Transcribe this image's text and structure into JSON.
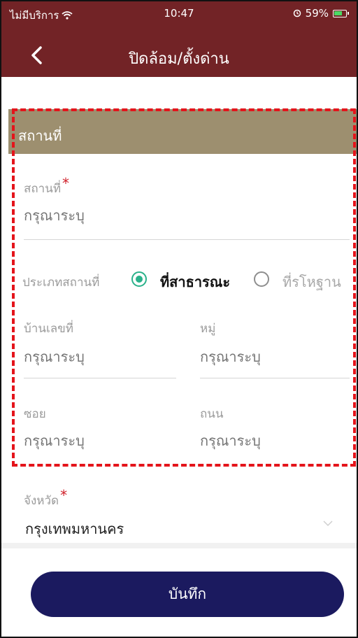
{
  "status_bar": {
    "carrier": "ไม่มีบริการ",
    "time": "10:47",
    "battery": "59%"
  },
  "header": {
    "title": "ปิดล้อม/ตั้งด่าน",
    "back_icon": "chevron-left-icon"
  },
  "section": {
    "title": "สถานที่"
  },
  "form": {
    "place": {
      "label": "สถานที่",
      "required_mark": "*",
      "placeholder": "กรุณาระบุ"
    },
    "place_type": {
      "label": "ประเภทสถานที่",
      "options": [
        {
          "label": "ที่สาธารณะ",
          "selected": true
        },
        {
          "label": "ที่รโหฐาน",
          "selected": false
        }
      ]
    },
    "house_no": {
      "label": "บ้านเลขที่",
      "placeholder": "กรุณาระบุ"
    },
    "moo": {
      "label": "หมู่",
      "placeholder": "กรุณาระบุ"
    },
    "soi": {
      "label": "ซอย",
      "placeholder": "กรุณาระบุ"
    },
    "road": {
      "label": "ถนน",
      "placeholder": "กรุณาระบุ"
    },
    "province": {
      "label": "จังหวัด",
      "required_mark": "*",
      "value": "กรุงเทพมหานคร"
    }
  },
  "save_button": {
    "label": "บันทึก"
  },
  "colors": {
    "header_bg": "#722326",
    "section_bg": "#9d8f6f",
    "radio_active": "#2ab18a",
    "button_bg": "#1b1a5f",
    "highlight_dash": "#e4141b"
  }
}
